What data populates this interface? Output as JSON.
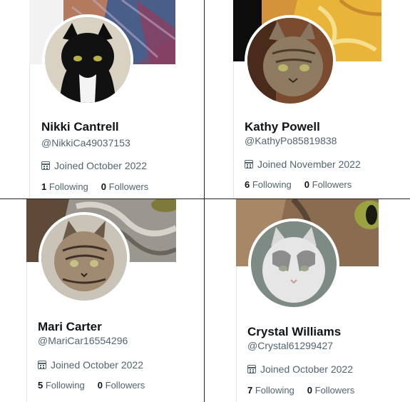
{
  "profiles": [
    {
      "name": "Nikki Cantrell",
      "handle": "@NikkiCa49037153",
      "joined": "Joined October 2022",
      "following_count": "1",
      "following_label": "Following",
      "followers_count": "0",
      "followers_label": "Followers",
      "avatar": "black-and-white-cat",
      "banner": "patterned-fabric"
    },
    {
      "name": "Kathy Powell",
      "handle": "@KathyPo85819838",
      "joined": "Joined November 2022",
      "following_count": "6",
      "following_label": "Following",
      "followers_count": "0",
      "followers_label": "Followers",
      "avatar": "tabby-cat",
      "banner": "yellow-fabric"
    },
    {
      "name": "Mari Carter",
      "handle": "@MariCar16554296",
      "joined": "Joined October 2022",
      "following_count": "5",
      "following_label": "Following",
      "followers_count": "0",
      "followers_label": "Followers",
      "avatar": "tabby-kitten",
      "banner": "tabby-fur-closeup"
    },
    {
      "name": "Crystal Williams",
      "handle": "@Crystal61299427",
      "joined": "Joined October 2022",
      "following_count": "7",
      "following_label": "Following",
      "followers_count": "0",
      "followers_label": "Followers",
      "avatar": "white-and-grey-cat",
      "banner": "cat-eye-closeup"
    }
  ],
  "colors": {
    "text": "#0f1419",
    "secondary": "#536471",
    "divider": "#222222"
  }
}
